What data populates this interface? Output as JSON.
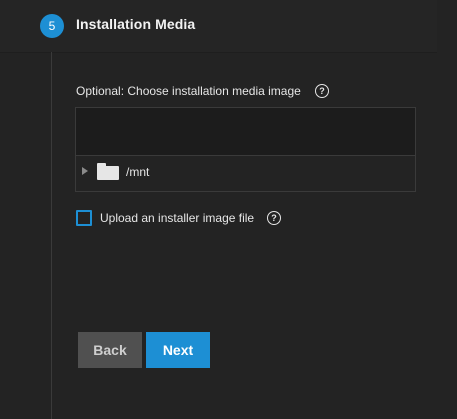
{
  "step": {
    "number": "5",
    "title": "Installation Media"
  },
  "media_field": {
    "label": "Optional: Choose installation media image",
    "help_icon": "?",
    "value": "",
    "tree": {
      "expand_icon": "chevron-right-icon",
      "folder_icon": "folder-icon",
      "root_label": "/mnt"
    }
  },
  "upload_option": {
    "label": "Upload an installer image file",
    "checked": false,
    "help_icon": "?"
  },
  "actions": {
    "back_label": "Back",
    "next_label": "Next"
  },
  "colors": {
    "accent": "#1d8fd4",
    "background": "#232323",
    "secondary_button": "#505050"
  }
}
